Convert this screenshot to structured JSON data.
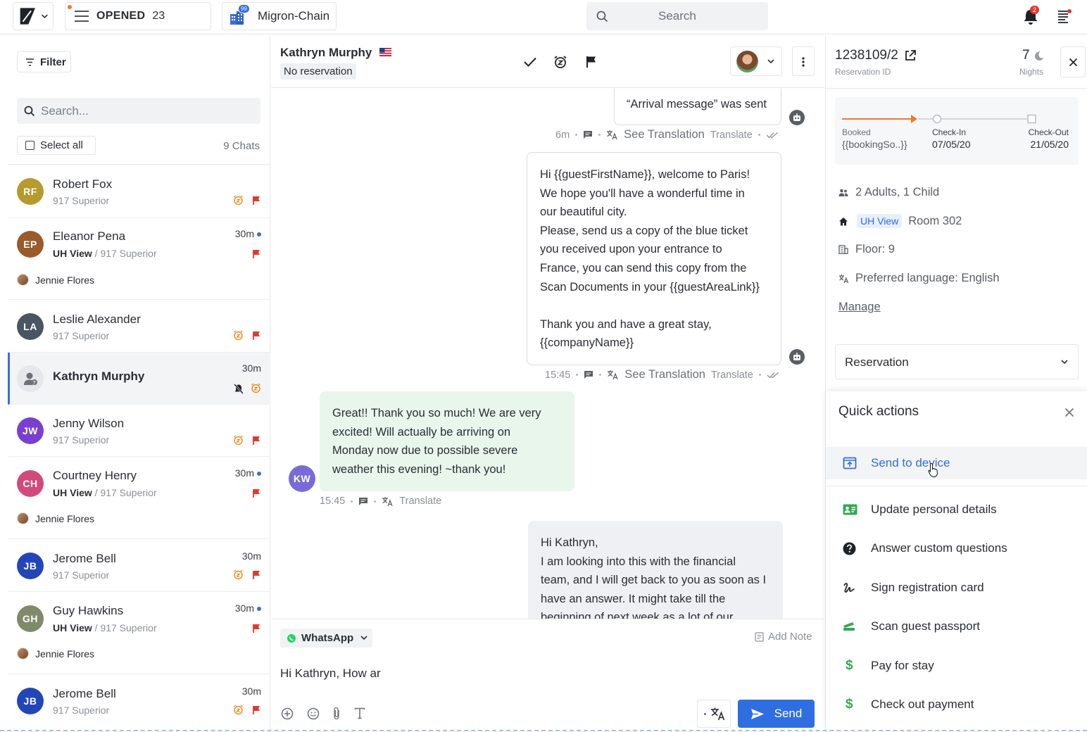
{
  "topbar": {
    "opened_label": "OPENED",
    "opened_count": "23",
    "property_name": "Migron-Chain",
    "property_badge": "99",
    "search_placeholder": "Search",
    "notification_count": "2"
  },
  "left": {
    "filter_label": "Filter",
    "search_placeholder": "Search...",
    "select_all_label": "Select all",
    "chat_count": "9 Chats",
    "chats": [
      {
        "initials": "RF",
        "name": "Robert Fox",
        "sub": "917 Superior",
        "color": "#b59a2e"
      },
      {
        "initials": "EP",
        "name": "Eleanor Pena",
        "tag": "UH View",
        "sep": "/",
        "sub": "917 Superior",
        "time": "30m",
        "agent": "Jennie Flores",
        "color": "#9a5a2a"
      },
      {
        "initials": "LA",
        "name": "Leslie Alexander",
        "sub": "917 Superior",
        "color": "#4a5563"
      },
      {
        "name": "Kathryn Murphy",
        "time": "30m"
      },
      {
        "initials": "JW",
        "name": "Jenny Wilson",
        "sub": "917 Superior",
        "color": "#7a3fd1"
      },
      {
        "initials": "CH",
        "name": "Courtney Henry",
        "tag": "UH View",
        "sep": "/",
        "sub": "917 Superior",
        "time": "30m",
        "agent": "Jennie Flores",
        "color": "#d24a7a"
      },
      {
        "initials": "JB",
        "name": "Jerome Bell",
        "sub": "917 Superior",
        "time": "30m",
        "color": "#2246b8"
      },
      {
        "initials": "GH",
        "name": "Guy Hawkins",
        "tag": "UH View",
        "sep": "/",
        "sub": "917 Superior",
        "time": "30m",
        "agent": "Jennie Flores",
        "color": "#7e8a6a"
      },
      {
        "initials": "JB",
        "name": "Jerome Bell",
        "sub": "917 Superior",
        "time": "30m",
        "color": "#2246b8"
      }
    ]
  },
  "conversation": {
    "guest_name": "Kathryn Murphy",
    "reservation_status": "No reservation",
    "messages": {
      "arrival": {
        "text": "“Arrival message” was sent",
        "time": "6m",
        "see_translation": "See Translation",
        "translate": "Translate"
      },
      "welcome": {
        "lines": [
          "Hi {{guestFirstName}}, welcome to Paris!",
          "We hope you'll have a wonderful time in",
          "our beautiful city.",
          "Please, send us a copy of the blue ticket",
          "you received upon your entrance to",
          "France, you can send this copy from the",
          "Scan Documents in your {{guestAreaLink}}",
          "",
          "Thank you and have a great stay,",
          "{{companyName}}"
        ],
        "time": "15:45",
        "see_translation": "See Translation",
        "translate": "Translate"
      },
      "guest": {
        "initials": "KW",
        "lines": [
          "Great!! Thank you so much! We are very",
          "excited! Will actually be arriving on",
          "Monday now due to possible severe",
          "weather this evening! ~thank you!"
        ],
        "time": "15:45",
        "translate": "Translate"
      },
      "reply": {
        "lines": [
          "Hi Kathryn,",
          "I am looking into this with the financial",
          "team, and I will get back to you as soon as I",
          "have an answer. It might take till the",
          "beginning of next week as a lot of our"
        ]
      }
    },
    "composer": {
      "channel": "WhatsApp",
      "add_note": "Add Note",
      "draft": "Hi Kathryn, How ar",
      "send_label": "Send"
    }
  },
  "reservation": {
    "id": "1238109/2",
    "id_label": "Reservation ID",
    "nights": "7",
    "nights_label": "Nights",
    "timeline": {
      "booked_label": "Booked",
      "booked_value": "{{bookingSo..}}",
      "checkin_label": "Check-In",
      "checkin_value": "07/05/20",
      "checkout_label": "Check-Out",
      "checkout_value": "21/05/20"
    },
    "guests": "2 Adults, 1 Child",
    "room_tag": "UH View",
    "room": "Room 302",
    "floor": "Floor: 9",
    "language": "Preferred language: English",
    "manage_label": "Manage",
    "section_select": "Reservation"
  },
  "quick_actions": {
    "title": "Quick actions",
    "items": [
      "Send to device",
      "Update personal details",
      "Answer custom questions",
      "Sign registration card",
      "Scan guest passport",
      "Pay for stay",
      "Check out payment"
    ]
  },
  "colors": {
    "accent": "#2f6ee0",
    "flag": "#e0392b",
    "alarm": "#f08a24",
    "progress": "#f07a2a",
    "whatsapp": "#25d366"
  }
}
